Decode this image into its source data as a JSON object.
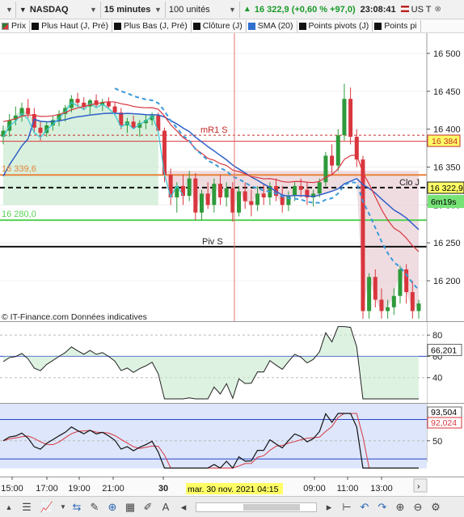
{
  "toolbar": {
    "symbol": "NASDAQ",
    "interval": "15 minutes",
    "units": "100 unités",
    "last_price": "16 322,9",
    "change": "(+0,60 % +97,0)",
    "clock": "23:08:41",
    "market": "US T"
  },
  "legend": [
    {
      "label": "Prix",
      "color": "#2e7d32"
    },
    {
      "label": "Plus Haut (J, Pré)",
      "color": "#111111"
    },
    {
      "label": "Plus Bas (J, Pré)",
      "color": "#111111"
    },
    {
      "label": "Clôture (J)",
      "color": "#111111"
    },
    {
      "label": "SMA (20)",
      "color": "#2f6fcf"
    },
    {
      "label": "Points pivots (J)",
      "color": "#111111"
    },
    {
      "label": "Points pi",
      "color": "#111111"
    }
  ],
  "price_axis": {
    "ticks": [
      "16 500",
      "16 450",
      "16 400",
      "16 350",
      "16 300",
      "16 250",
      "16 200"
    ],
    "tick_values": [
      16500,
      16450,
      16400,
      16350,
      16300,
      16250,
      16200
    ],
    "price_box_red": "16 384",
    "price_box_current": "16 322,9",
    "countdown": "6m19s"
  },
  "level_labels": {
    "mr1": "mR1 S",
    "left_orange": "16 339,6",
    "left_green": "16 280,0",
    "clo": "Clo J",
    "piv": "Piv S"
  },
  "watermark": "© IT-Finance.com  Données indicatives",
  "osc1": {
    "ticks": [
      "80",
      "60",
      "40"
    ],
    "box": "66,201"
  },
  "osc2": {
    "ticks": [
      "50"
    ],
    "box_dark": "93,504",
    "box_red": "92,024"
  },
  "time_axis": {
    "ticks": [
      "15:00",
      "17:00",
      "19:00",
      "21:00",
      "30",
      "09:00",
      "11:00",
      "13:00"
    ],
    "cursor_label": "mar. 30 nov. 2021 04:15"
  },
  "colors": {
    "up": "#2e9a3a",
    "down": "#d9363e",
    "sma": "#2f5fc8",
    "cyan": "#36c7d9",
    "pivot_orange": "#e8843c",
    "pivot_green": "#55d155"
  },
  "chart_data": {
    "type": "candlestick",
    "ylim": [
      16150,
      16520
    ],
    "candles": [
      [
        16390,
        16405,
        16380,
        16398
      ],
      [
        16398,
        16420,
        16390,
        16412
      ],
      [
        16412,
        16430,
        16405,
        16418
      ],
      [
        16418,
        16435,
        16410,
        16428
      ],
      [
        16428,
        16440,
        16415,
        16420
      ],
      [
        16420,
        16428,
        16395,
        16402
      ],
      [
        16402,
        16410,
        16385,
        16395
      ],
      [
        16395,
        16410,
        16390,
        16405
      ],
      [
        16405,
        16418,
        16398,
        16412
      ],
      [
        16412,
        16425,
        16404,
        16420
      ],
      [
        16420,
        16432,
        16410,
        16428
      ],
      [
        16428,
        16445,
        16422,
        16440
      ],
      [
        16440,
        16448,
        16430,
        16435
      ],
      [
        16435,
        16442,
        16425,
        16430
      ],
      [
        16430,
        16440,
        16420,
        16438
      ],
      [
        16438,
        16446,
        16428,
        16432
      ],
      [
        16432,
        16440,
        16424,
        16436
      ],
      [
        16436,
        16442,
        16428,
        16430
      ],
      [
        16430,
        16436,
        16418,
        16422
      ],
      [
        16422,
        16428,
        16400,
        16405
      ],
      [
        16405,
        16415,
        16395,
        16410
      ],
      [
        16410,
        16418,
        16400,
        16402
      ],
      [
        16402,
        16412,
        16390,
        16408
      ],
      [
        16408,
        16420,
        16400,
        16412
      ],
      [
        16412,
        16422,
        16405,
        16418
      ],
      [
        16418,
        16422,
        16395,
        16398
      ],
      [
        16398,
        16402,
        16330,
        16340
      ],
      [
        16340,
        16348,
        16300,
        16310
      ],
      [
        16310,
        16330,
        16290,
        16325
      ],
      [
        16325,
        16340,
        16300,
        16312
      ],
      [
        16312,
        16345,
        16305,
        16335
      ],
      [
        16335,
        16342,
        16280,
        16290
      ],
      [
        16290,
        16320,
        16280,
        16315
      ],
      [
        16315,
        16330,
        16295,
        16300
      ],
      [
        16300,
        16335,
        16290,
        16328
      ],
      [
        16328,
        16340,
        16300,
        16310
      ],
      [
        16310,
        16330,
        16298,
        16322
      ],
      [
        16322,
        16330,
        16278,
        16290
      ],
      [
        16290,
        16325,
        16285,
        16318
      ],
      [
        16318,
        16330,
        16295,
        16305
      ],
      [
        16305,
        16320,
        16285,
        16300
      ],
      [
        16300,
        16325,
        16292,
        16315
      ],
      [
        16315,
        16328,
        16300,
        16310
      ],
      [
        16310,
        16330,
        16300,
        16325
      ],
      [
        16325,
        16335,
        16305,
        16312
      ],
      [
        16312,
        16325,
        16290,
        16300
      ],
      [
        16300,
        16318,
        16292,
        16312
      ],
      [
        16312,
        16330,
        16305,
        16325
      ],
      [
        16325,
        16335,
        16310,
        16320
      ],
      [
        16320,
        16330,
        16300,
        16310
      ],
      [
        16310,
        16320,
        16298,
        16315
      ],
      [
        16315,
        16335,
        16310,
        16330
      ],
      [
        16330,
        16370,
        16325,
        16365
      ],
      [
        16365,
        16380,
        16340,
        16352
      ],
      [
        16352,
        16400,
        16345,
        16392
      ],
      [
        16392,
        16460,
        16385,
        16440
      ],
      [
        16440,
        16455,
        16380,
        16390
      ],
      [
        16390,
        16400,
        16350,
        16360
      ],
      [
        16360,
        16365,
        16150,
        16160
      ],
      [
        16160,
        16210,
        16150,
        16205
      ],
      [
        16205,
        16215,
        16165,
        16175
      ],
      [
        16175,
        16190,
        16150,
        16160
      ],
      [
        16160,
        16175,
        16150,
        16165
      ],
      [
        16165,
        16190,
        16155,
        16180
      ],
      [
        16180,
        16220,
        16170,
        16215
      ],
      [
        16215,
        16222,
        16170,
        16185
      ],
      [
        16185,
        16200,
        16150,
        16160
      ],
      [
        16160,
        16175,
        16150,
        16170
      ]
    ]
  }
}
